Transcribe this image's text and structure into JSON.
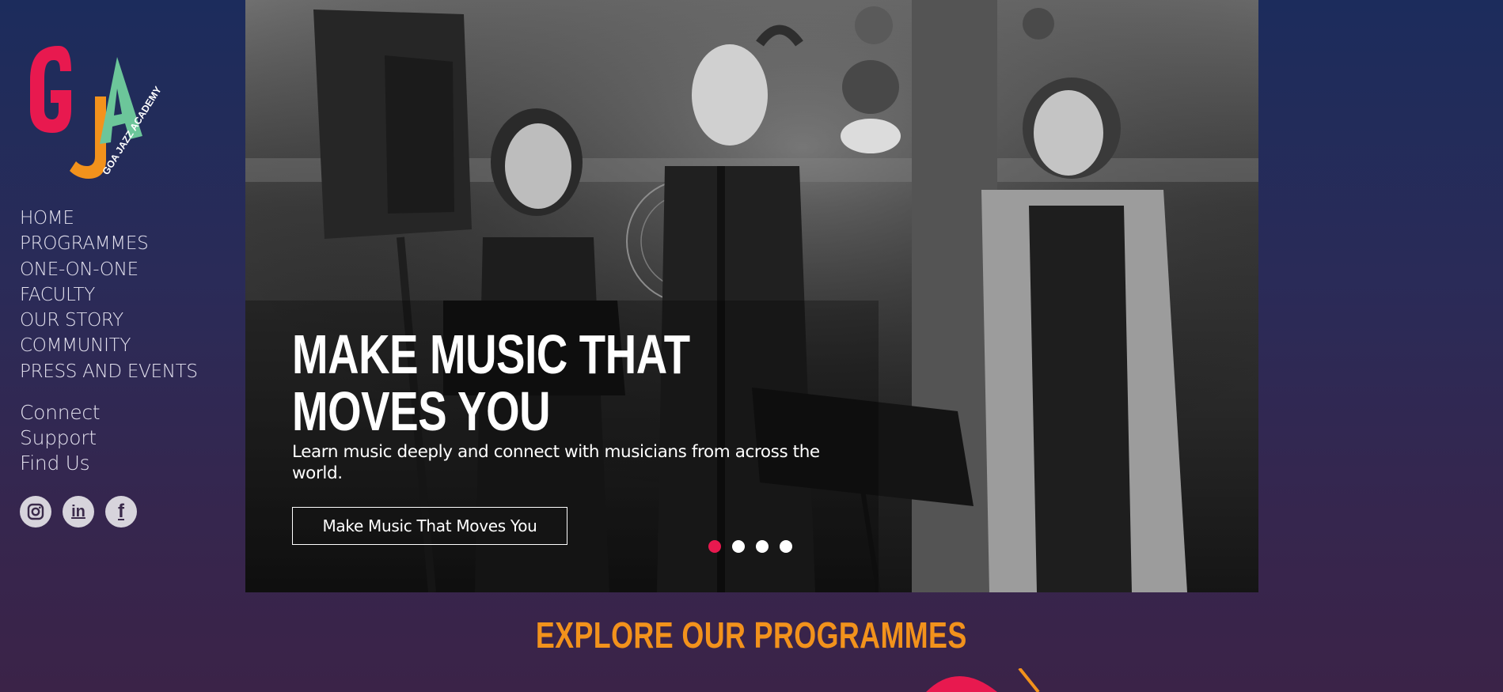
{
  "brand": {
    "logo_letters": [
      "G",
      "J",
      "A"
    ],
    "logo_text": "GOA JAZZ ACADEMY",
    "colors": {
      "g": "#e8194f",
      "j": "#f2921c",
      "a": "#6cc69a"
    }
  },
  "nav": {
    "primary": [
      "HOME",
      "PROGRAMMES",
      "ONE-ON-ONE",
      "FACULTY",
      "OUR STORY",
      "COMMUNITY",
      "PRESS AND EVENTS"
    ],
    "secondary": [
      "Connect",
      "Support",
      "Find Us"
    ]
  },
  "socials": [
    {
      "icon": "instagram-icon"
    },
    {
      "icon": "linkedin-icon",
      "glyph": "in"
    },
    {
      "icon": "facebook-icon",
      "glyph": "f"
    }
  ],
  "hero": {
    "title": "MAKE MUSIC THAT MOVES YOU",
    "subtitle": "Learn music deeply and connect with musicians from across the world.",
    "cta": "Make Music That Moves You",
    "slides": 4,
    "active_slide": 1,
    "active_dot_color": "#e8194f"
  },
  "explore": {
    "heading": "EXPLORE OUR PROGRAMMES",
    "color": "#f2921c"
  }
}
